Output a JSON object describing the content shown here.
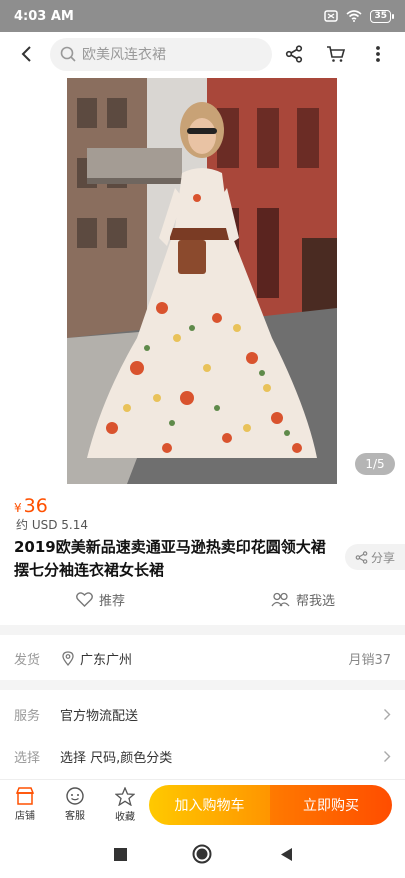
{
  "status_bar": {
    "time": "4:03 AM",
    "battery": "35"
  },
  "header": {
    "search_placeholder": "欧美风连衣裙"
  },
  "image": {
    "counter": "1/5"
  },
  "product": {
    "currency": "¥",
    "price": "36",
    "usd": "约 USD 5.14",
    "title": "2019欧美新品速卖通亚马逊热卖印花圆领大裙摆七分袖连衣裙女长裙",
    "share_label": "分享",
    "recommend_label": "推荐",
    "help_pick_label": "帮我选"
  },
  "shipping": {
    "label": "发货",
    "location": "广东广州",
    "monthly_sales": "月销37"
  },
  "service": {
    "label": "服务",
    "value": "官方物流配送"
  },
  "select": {
    "label": "选择",
    "value": "选择 尺码,颜色分类"
  },
  "bottom_bar": {
    "store": "店铺",
    "support": "客服",
    "favorite": "收藏",
    "add_to_cart": "加入购物车",
    "buy_now": "立即购买"
  },
  "colors": {
    "accent": "#ff5000",
    "cart_button": "#ffb000",
    "buy_button": "#ff5a00"
  }
}
